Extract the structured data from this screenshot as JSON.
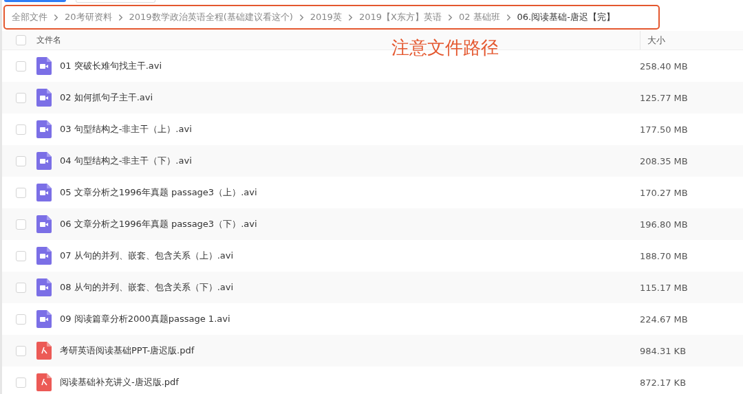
{
  "breadcrumb": [
    {
      "label": "全部文件",
      "current": false
    },
    {
      "label": "20考研资料",
      "current": false
    },
    {
      "label": "2019数学政治英语全程(基础建议看这个)",
      "current": false
    },
    {
      "label": "2019英",
      "current": false
    },
    {
      "label": "2019【X东方】英语",
      "current": false
    },
    {
      "label": "02 基础班",
      "current": false
    },
    {
      "label": "06.阅读基础-唐迟【完】",
      "current": true
    }
  ],
  "annotation": "注意文件路径",
  "table": {
    "columns": [
      "文件名",
      "大小"
    ],
    "select_all": {
      "checked": false
    },
    "rows": [
      {
        "kind": "video",
        "name": "01 突破长难句找主干.avi",
        "size": "258.40 MB",
        "checked": false
      },
      {
        "kind": "video",
        "name": "02 如何抓句子主干.avi",
        "size": "125.77 MB",
        "checked": false
      },
      {
        "kind": "video",
        "name": "03 句型结构之-非主干（上）.avi",
        "size": "177.50 MB",
        "checked": false
      },
      {
        "kind": "video",
        "name": "04 句型结构之-非主干（下）.avi",
        "size": "208.35 MB",
        "checked": false
      },
      {
        "kind": "video",
        "name": "05 文章分析之1996年真题 passage3（上）.avi",
        "size": "170.27 MB",
        "checked": false
      },
      {
        "kind": "video",
        "name": "06 文章分析之1996年真题 passage3（下）.avi",
        "size": "196.80 MB",
        "checked": false
      },
      {
        "kind": "video",
        "name": "07 从句的并列、嵌套、包含关系（上）.avi",
        "size": "188.70 MB",
        "checked": false
      },
      {
        "kind": "video",
        "name": "08 从句的并列、嵌套、包含关系（下）.avi",
        "size": "115.17 MB",
        "checked": false
      },
      {
        "kind": "video",
        "name": "09 阅读篇章分析2000真题passage 1.avi",
        "size": "224.67 MB",
        "checked": false
      },
      {
        "kind": "pdf",
        "name": "考研英语阅读基础PPT-唐迟版.pdf",
        "size": "984.31 KB",
        "checked": false
      },
      {
        "kind": "pdf",
        "name": "阅读基础补充讲义-唐迟版.pdf",
        "size": "872.17 KB",
        "checked": false
      }
    ]
  }
}
